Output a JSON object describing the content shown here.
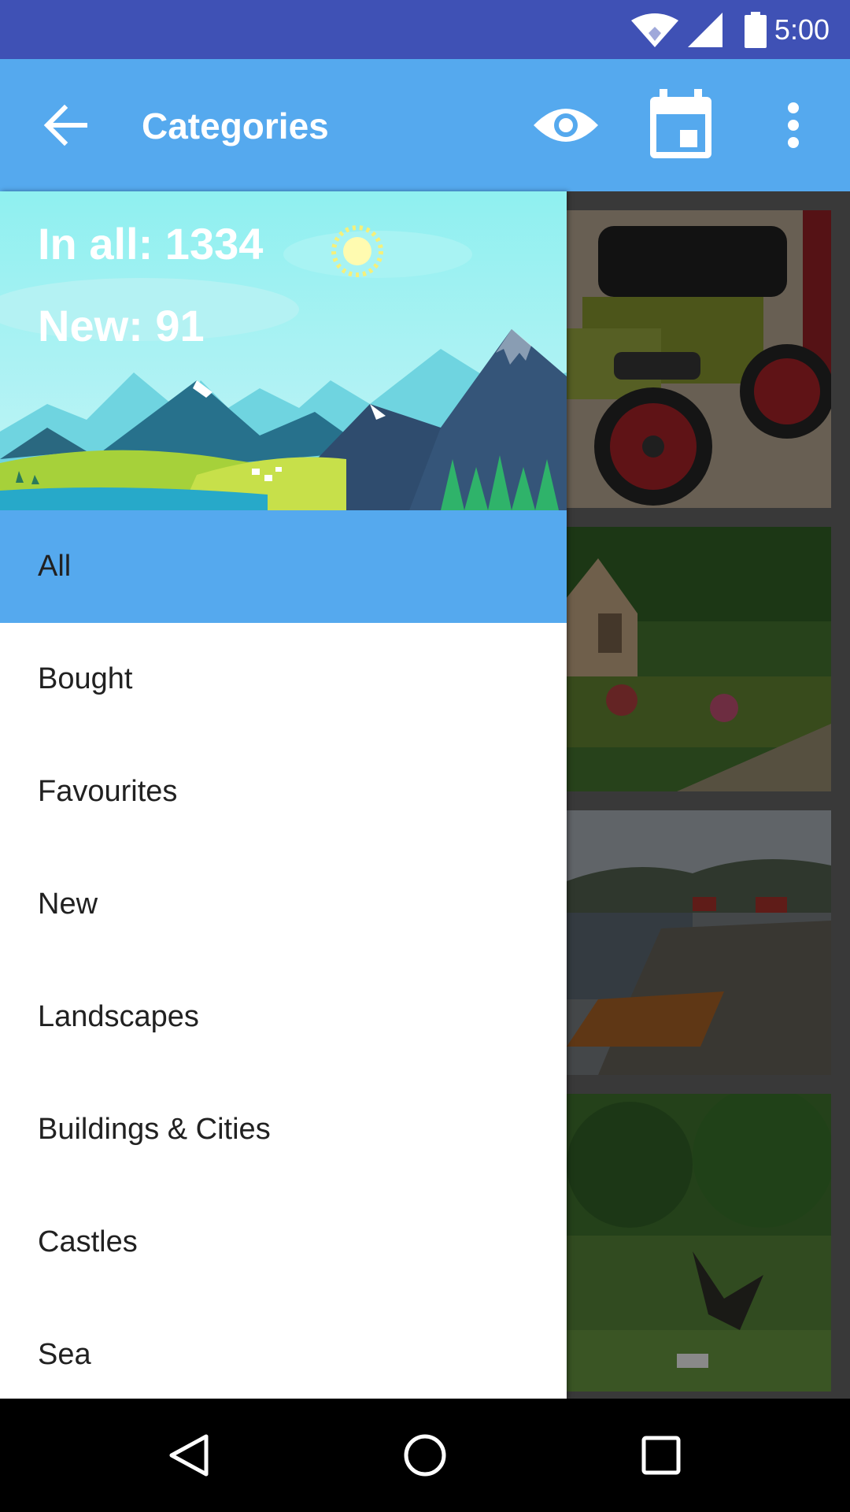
{
  "status_bar": {
    "time": "5:00"
  },
  "app_bar": {
    "title": "Categories"
  },
  "drawer": {
    "header": {
      "in_all": "In all: 1334",
      "new": "New: 91"
    },
    "items": [
      {
        "label": "All",
        "active": true
      },
      {
        "label": "Bought",
        "active": false
      },
      {
        "label": "Favourites",
        "active": false
      },
      {
        "label": "New",
        "active": false
      },
      {
        "label": "Landscapes",
        "active": false
      },
      {
        "label": "Buildings & Cities",
        "active": false
      },
      {
        "label": "Castles",
        "active": false
      },
      {
        "label": "Sea",
        "active": false
      }
    ]
  },
  "icons": {
    "status": [
      "wifi-icon",
      "signal-icon",
      "battery-icon"
    ],
    "app_bar": [
      "back-arrow-icon",
      "eye-icon",
      "calendar-icon",
      "more-vert-icon"
    ],
    "nav": [
      "back-triangle-icon",
      "home-circle-icon",
      "recents-square-icon"
    ]
  },
  "colors": {
    "status_bar": "#3f51b5",
    "app_bar": "#55a9ee",
    "active_item": "#55a9ee"
  }
}
